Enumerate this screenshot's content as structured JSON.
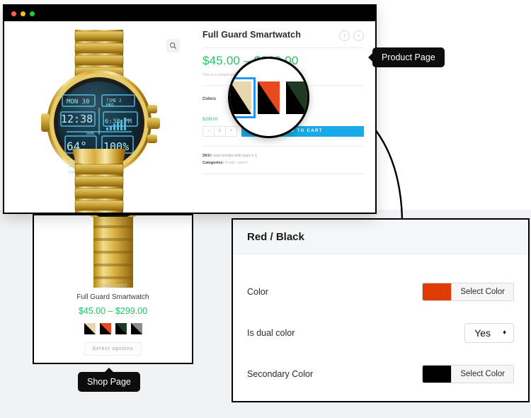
{
  "window": {
    "traffic_lights": [
      "close",
      "minimize",
      "maximize"
    ],
    "zoom_icon": "search-zoom-icon"
  },
  "product_page": {
    "title": "Full Guard Smartwatch",
    "nav_prev": "‹",
    "nav_next": "›",
    "price": "$45.00 – $299.00",
    "description": "This is a simple pro",
    "attribute_label": "Colors",
    "selected_price": "$299.00",
    "qty_minus": "–",
    "qty_value": "1",
    "qty_plus": "+",
    "add_to_cart": "ADD TO CART",
    "sku_label": "SKU:",
    "sku_value": "woo-hoodie-with-logo-1-1",
    "categories_label": "Categories:",
    "categories_value": "Radio, watch",
    "swatches": [
      {
        "name": "cream",
        "primary": "#000000",
        "secondary": "#e8d7ae",
        "selected": true
      },
      {
        "name": "red-black",
        "primary": "#000000",
        "secondary": "#e8491f",
        "selected": false
      },
      {
        "name": "dark-green",
        "primary": "#000000",
        "secondary": "#1e3b22",
        "selected": false
      },
      {
        "name": "grey",
        "primary": "#000000",
        "secondary": "#8d8d8d",
        "selected": false
      }
    ]
  },
  "shop_page": {
    "category": "Radio, watch",
    "title": "Full Guard Smartwatch",
    "price": "$45.00 – $299.00",
    "select_options": "Select options",
    "swatches": [
      {
        "name": "cream",
        "primary": "#000000",
        "secondary": "#e8d7ae"
      },
      {
        "name": "red-black",
        "primary": "#000000",
        "secondary": "#e8491f"
      },
      {
        "name": "dark-green",
        "primary": "#000000",
        "secondary": "#1e3b22"
      },
      {
        "name": "grey",
        "primary": "#000000",
        "secondary": "#8d8d8d"
      }
    ]
  },
  "magnifier": {
    "swatches": [
      {
        "name": "cream",
        "primary": "#000000",
        "secondary": "#e8d7ae",
        "selected": true
      },
      {
        "name": "red-black",
        "primary": "#000000",
        "secondary": "#e8491f",
        "selected": false
      },
      {
        "name": "dark-green",
        "primary": "#000000",
        "secondary": "#1e3b22",
        "selected": false
      }
    ]
  },
  "settings_panel": {
    "title": "Red / Black",
    "rows": [
      {
        "label": "Color",
        "type": "color",
        "swatch": "#de3d06",
        "button": "Select Color"
      },
      {
        "label": "Is dual color",
        "type": "select",
        "value": "Yes"
      },
      {
        "label": "Secondary Color",
        "type": "color",
        "swatch": "#000000",
        "button": "Select Color"
      }
    ]
  },
  "tooltips": {
    "product_page": "Product Page",
    "shop_page": "Shop Page"
  },
  "colors": {
    "accent_blue": "#17a9e8",
    "price_green": "#22c667",
    "selection_blue": "#2196f3"
  }
}
